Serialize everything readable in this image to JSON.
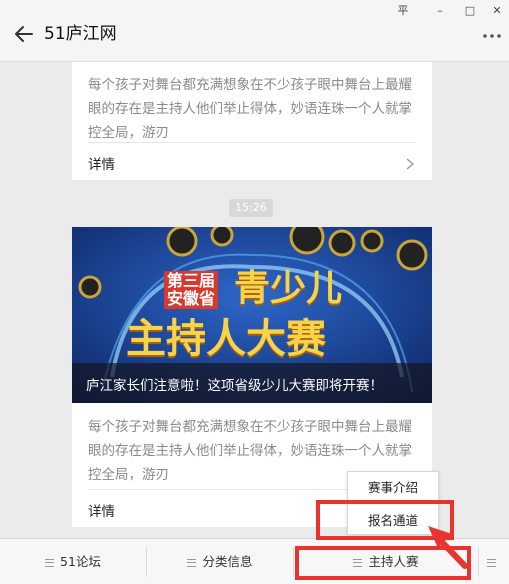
{
  "window": {
    "pin_glyph": "平",
    "minimize_glyph": "–",
    "maximize_glyph": "□",
    "close_glyph": "✕"
  },
  "header": {
    "title": "51庐江网",
    "back_icon": "arrow-left-icon",
    "more_icon": "more-dots-icon"
  },
  "messages": {
    "card1": {
      "text": "每个孩子对舞台都充满想象在不少孩子眼中舞台上最耀眼的存在是主持人他们举止得体，妙语连珠一个人就掌控全局，游刃",
      "detail_label": "详情"
    },
    "timestamp": "15:26",
    "card2": {
      "cover_words": {
        "line1_a": "第三届",
        "line1_b": "安徽省",
        "line1_c": "青少儿",
        "line2": "主持人大赛"
      },
      "headline": "庐江家长们注意啦！这项省级少儿大赛即将开赛！",
      "text": "每个孩子对舞台都充满想象在不少孩子眼中舞台上最耀眼的存在是主持人他们举止得体，妙语连珠一个人就掌控全局，游刃",
      "detail_label": "详情"
    }
  },
  "menu": {
    "items": [
      {
        "label": "51论坛"
      },
      {
        "label": "分类信息"
      },
      {
        "label": "主持人赛"
      }
    ],
    "submenu": [
      {
        "label": "赛事介绍"
      },
      {
        "label": "报名通道"
      }
    ]
  },
  "colors": {
    "accent_red": "#e8332e",
    "cover_blue": "#1a3b86",
    "cover_gold": "#f3c23a"
  }
}
